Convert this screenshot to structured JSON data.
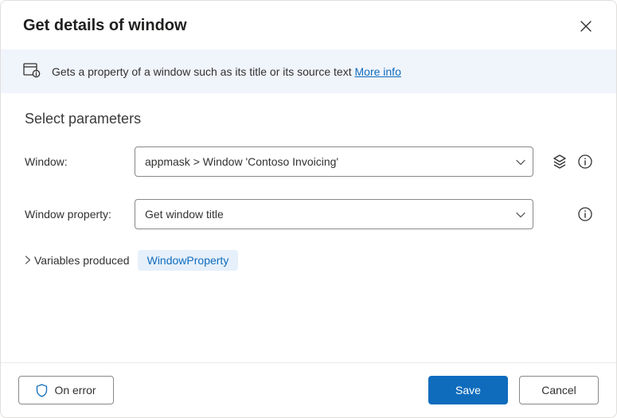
{
  "header": {
    "title": "Get details of window"
  },
  "banner": {
    "text": "Gets a property of a window such as its title or its source text ",
    "link_label": "More info"
  },
  "section": {
    "heading": "Select parameters"
  },
  "form": {
    "window": {
      "label": "Window:",
      "value": "appmask > Window 'Contoso Invoicing'"
    },
    "window_property": {
      "label": "Window property:",
      "value": "Get window title"
    }
  },
  "variables": {
    "label": "Variables produced",
    "chip": "WindowProperty"
  },
  "footer": {
    "on_error": "On error",
    "save": "Save",
    "cancel": "Cancel"
  }
}
